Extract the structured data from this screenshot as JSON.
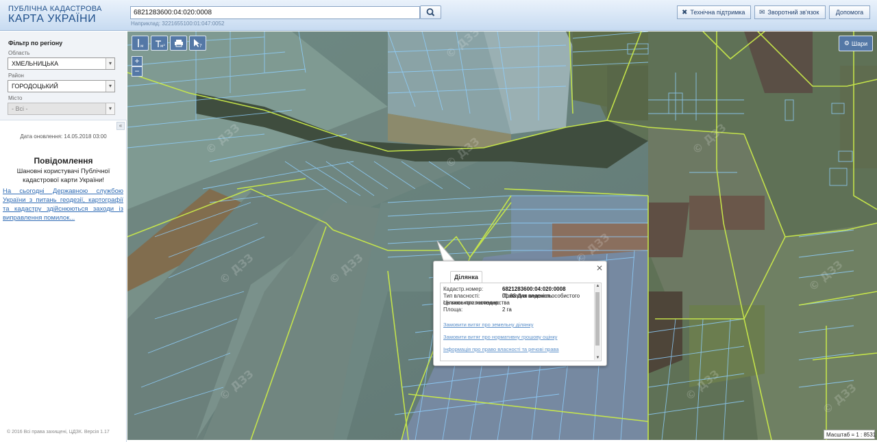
{
  "header": {
    "logo_line1": "ПУБЛІЧНА КАДАСТРОВА",
    "logo_line2": "КАРТА УКРАЇНИ",
    "search_value": "6821283600:04:020:0008",
    "search_example": "Наприклад: 3221655100:01:047:0052",
    "buttons": {
      "support": "Технічна підтримка",
      "feedback": "Зворотний зв'язок",
      "help": "Допомога"
    }
  },
  "sidebar": {
    "filter_title": "Фільтр по регіону",
    "region_label": "Область",
    "region_value": "ХМЕЛЬНИЦЬКА",
    "district_label": "Район",
    "district_value": "ГОРОДОЦЬКИЙ",
    "city_label": "Місто",
    "city_value": "- Всі -",
    "update_date": "Дата оновлення: 14.05.2018 03:00",
    "news_title": "Повідомлення",
    "news_text": "Шановні користувачі Публічної кадастрової карти України!",
    "news_link": "На сьогодні Державною службою України з питань геодезії, картографії та кадастру здійснюються заходи із виправлення помилок...",
    "copyright": "© 2016 Всі права захищені, ЦДЗК. Версія 1.17"
  },
  "map": {
    "tools": [
      "ruler",
      "area",
      "print",
      "identify"
    ],
    "zoom_in": "+",
    "zoom_out": "−",
    "layers_label": "Шари",
    "scale_text": "Масштаб = 1 : 8531",
    "watermark": "© ДЗЗ"
  },
  "popup": {
    "tab_label": "Ділянка",
    "rows": [
      {
        "key": "Кадастр.номер:",
        "value": "6821283600:04:020:0008"
      },
      {
        "key": "Тип власності:",
        "value": "Приватна власність"
      },
      {
        "key": "Цільове призначення:",
        "value": "01.03 Для ведення особистого селянського господарства"
      },
      {
        "key": "Площа:",
        "value": "2 га"
      }
    ],
    "links": [
      "Замовити витяг про земельну ділянку",
      "Замовити витяг про нормативну грошову оцінку",
      "Інформація про право власності та речові права"
    ]
  },
  "colors": {
    "header_text": "#1f4f8a",
    "parcel_outline": "#8fd0ff",
    "boundary_outline": "#c9e94a",
    "tool_bg": "#5478a6",
    "link": "#2e6bb4"
  }
}
